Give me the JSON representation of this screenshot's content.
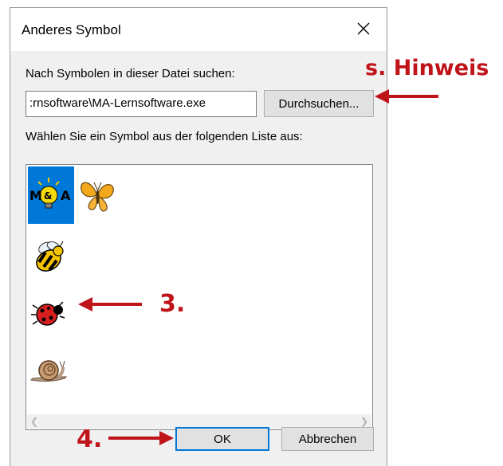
{
  "dialog": {
    "title": "Anderes Symbol",
    "search_label": "Nach Symbolen in dieser Datei suchen:",
    "path_value": ":rnsoftware\\MA-Lernsoftware.exe",
    "browse_label": "Durchsuchen...",
    "list_label": "Wählen Sie ein Symbol aus der folgenden Liste aus:",
    "ok_label": "OK",
    "cancel_label": "Abbrechen",
    "icons": [
      "ma-logo-icon",
      "butterfly-icon",
      "bee-icon",
      "ladybug-icon",
      "snail-icon"
    ]
  },
  "annotations": {
    "hint": "s. Hinweis",
    "step3": "3.",
    "step4": "4."
  },
  "colors": {
    "accent": "#0078d7",
    "annotation": "#c0141b"
  }
}
